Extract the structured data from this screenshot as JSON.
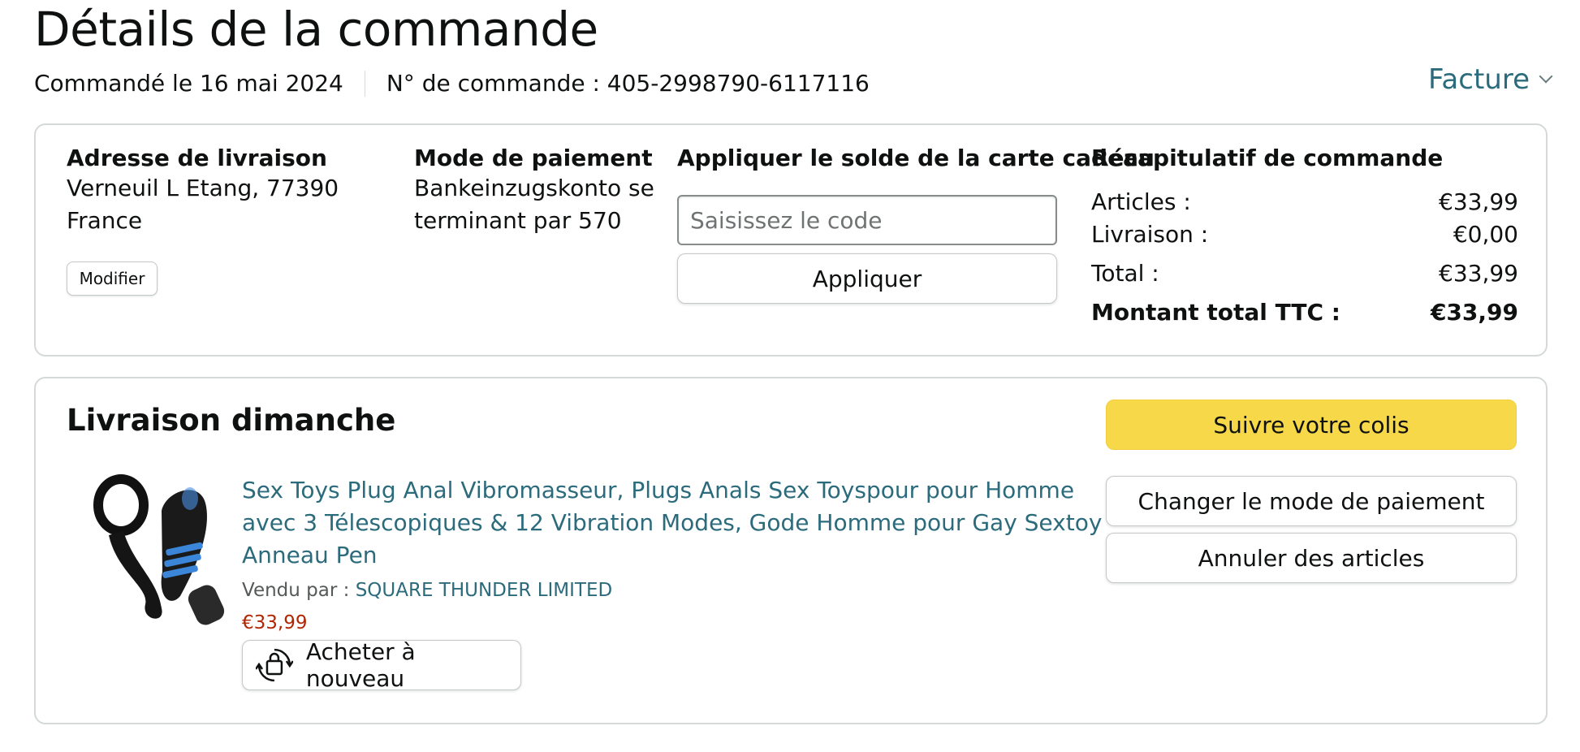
{
  "header": {
    "title": "Détails de la commande",
    "ordered_on": "Commandé le 16 mai 2024",
    "order_number": "N° de commande : 405-2998790-6117116",
    "invoice_label": "Facture"
  },
  "summary_card": {
    "shipping": {
      "heading": "Adresse de livraison",
      "line1": "Verneuil L Etang, 77390",
      "line2": "France",
      "modify_label": "Modifier"
    },
    "payment": {
      "heading": "Mode de paiement",
      "line1": "Bankeinzugskonto se",
      "line2": "terminant par 570"
    },
    "gift_card": {
      "heading": "Appliquer le solde de la carte cadeau",
      "placeholder": "Saisissez le code",
      "apply_label": "Appliquer"
    },
    "order_summary": {
      "heading": "Récapitulatif de commande",
      "rows": [
        {
          "label": "Articles :",
          "value": "€33,99"
        },
        {
          "label": "Livraison :",
          "value": "€0,00"
        },
        {
          "label": "Total :",
          "value": "€33,99"
        },
        {
          "label": "Montant total TTC :",
          "value": "€33,99"
        }
      ]
    }
  },
  "shipment": {
    "title": "Livraison dimanche",
    "product_title": "Sex Toys Plug Anal Vibromasseur, Plugs Anals Sex Toyspour pour Homme avec 3 Télescopiques & 12 Vibration Modes, Gode Homme pour Gay Sextoy Anneau Pen",
    "sold_by_label": "Vendu par : ",
    "seller": "SQUARE THUNDER LIMITED",
    "price": "€33,99",
    "buy_again_label": "Acheter à nouveau",
    "actions": {
      "track": "Suivre votre colis",
      "change_payment": "Changer le mode de paiement",
      "cancel": "Annuler des articles"
    }
  },
  "colors": {
    "link": "#2c6b7c",
    "price": "#b12704",
    "primary_button": "#f7d849",
    "border": "#d5d9d9"
  },
  "icons": [
    "chevron-down-icon",
    "product-image",
    "buy-again-icon"
  ]
}
